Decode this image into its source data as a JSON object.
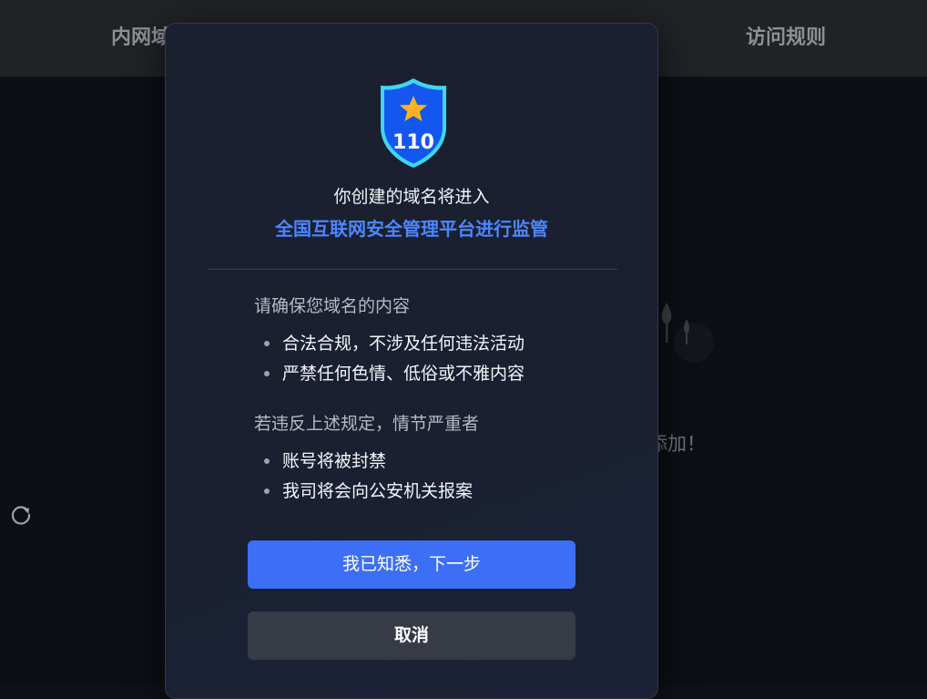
{
  "background": {
    "tabs": [
      {
        "label": "内网域"
      },
      {
        "label": "访问规则"
      }
    ],
    "empty_state_text": "添加！"
  },
  "modal": {
    "badge_number": "110",
    "headline": "你创建的域名将进入",
    "highlight": "全国互联网安全管理平台进行监管",
    "section1": {
      "title": "请确保您域名的内容",
      "items": [
        "合法合规，不涉及任何违法活动",
        "严禁任何色情、低俗或不雅内容"
      ]
    },
    "section2": {
      "title": "若违反上述规定，情节严重者",
      "items": [
        "账号将被封禁",
        "我司将会向公安机关报案"
      ]
    },
    "confirm_label": "我已知悉，下一步",
    "cancel_label": "取消"
  },
  "colors": {
    "accent": "#3c6ff6",
    "highlight_text": "#4d86ff",
    "badge_blue": "#1456f0",
    "badge_border": "#3fd6f2",
    "star": "#ffb21e"
  }
}
